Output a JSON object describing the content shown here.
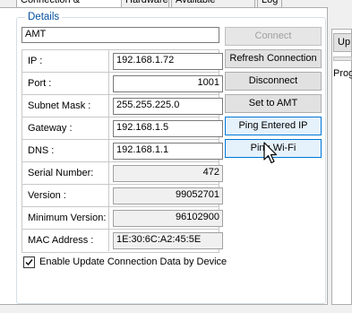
{
  "tabs": [
    {
      "label": "Connection & Firmware",
      "active": true
    },
    {
      "label": "Hardware",
      "active": false
    },
    {
      "label": "Available Devices",
      "active": false
    },
    {
      "label": "Log",
      "active": false
    }
  ],
  "details": {
    "legend": "Details",
    "device_name": "AMT",
    "fields": [
      {
        "label": "IP :",
        "value": "192.168.1.72",
        "align": "left",
        "readonly": false
      },
      {
        "label": "Port :",
        "value": "1001",
        "align": "right",
        "readonly": false
      },
      {
        "label": "Subnet Mask :",
        "value": "255.255.225.0",
        "align": "left",
        "readonly": false
      },
      {
        "label": "Gateway :",
        "value": "192.168.1.5",
        "align": "left",
        "readonly": false
      },
      {
        "label": "DNS :",
        "value": "192.168.1.1",
        "align": "left",
        "readonly": false
      },
      {
        "label": "Serial Number:",
        "value": "472",
        "align": "right",
        "readonly": true
      },
      {
        "label": "Version :",
        "value": "99052701",
        "align": "right",
        "readonly": true
      },
      {
        "label": "Minimum Version:",
        "value": "96102900",
        "align": "right",
        "readonly": true
      },
      {
        "label": "MAC Address :",
        "value": "1E:30:6C:A2:45:5E",
        "align": "left",
        "readonly": true
      }
    ],
    "checkbox": {
      "label": "Enable Update Connection Data by Device",
      "checked": true
    }
  },
  "buttons": {
    "connect": "Connect",
    "refresh_connection": "Refresh Connection",
    "disconnect": "Disconnect",
    "set_to_amt": "Set to AMT",
    "ping_entered_ip": "Ping Entered IP",
    "ping_wifi": "Ping Wi-Fi"
  },
  "side_panel": {
    "button_label": "Up",
    "progress_label": "Prog"
  },
  "colors": {
    "legend": "#0050a0",
    "focus_border": "#0078d7",
    "button_face": "#e1e1e1"
  }
}
